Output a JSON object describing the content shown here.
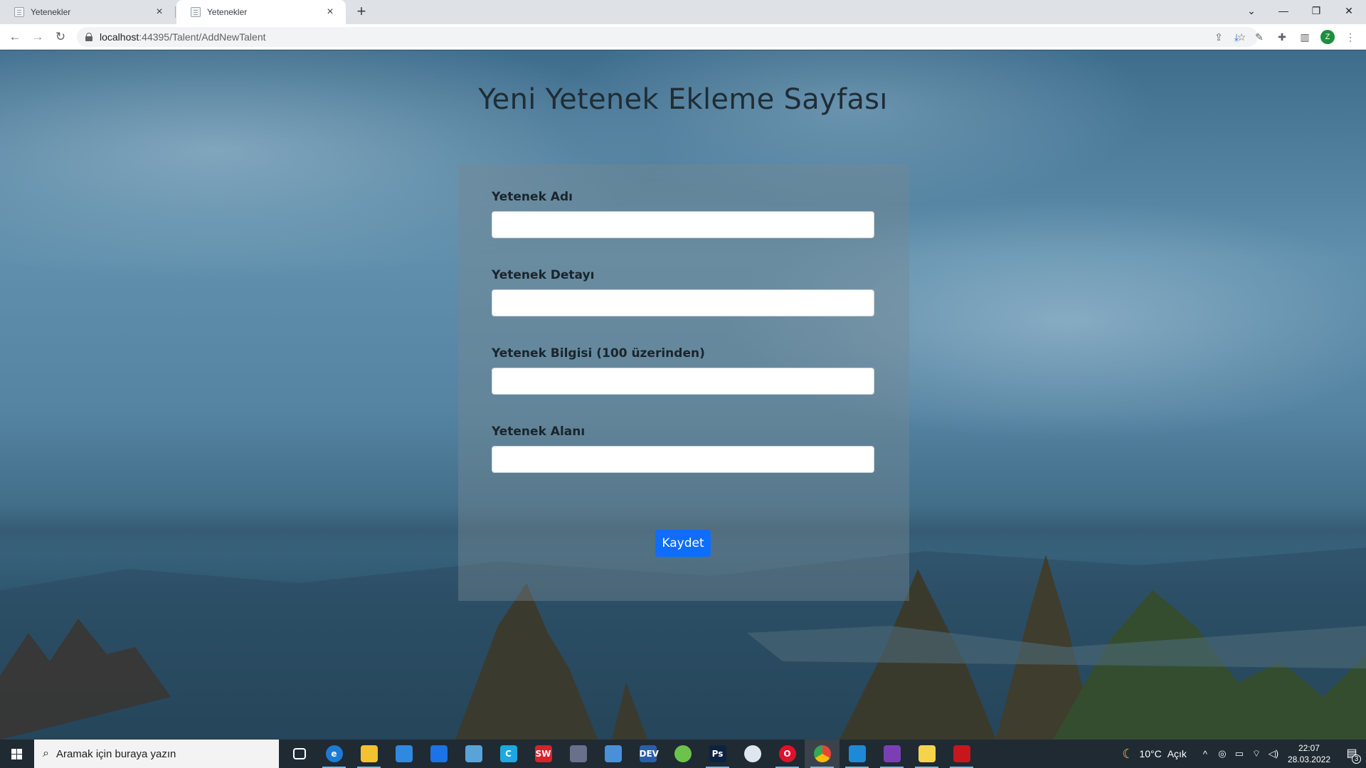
{
  "browser": {
    "tabs": [
      {
        "title": "Yetenekler"
      },
      {
        "title": "Yetenekler"
      }
    ],
    "new_tab_icon": "+",
    "url_host": "localhost",
    "url_path": ":44395/Talent/AddNewTalent",
    "window_controls": {
      "tab_list": "⌄",
      "minimize": "—",
      "maximize": "❐",
      "close": "✕"
    },
    "nav": {
      "back": "←",
      "forward": "→",
      "reload": "↻"
    },
    "profile_initial": "Z"
  },
  "page": {
    "title": "Yeni Yetenek Ekleme Sayfası",
    "fields": [
      {
        "label": "Yetenek Adı",
        "value": ""
      },
      {
        "label": "Yetenek Detayı",
        "value": ""
      },
      {
        "label": "Yetenek Bilgisi (100 üzerinden)",
        "value": ""
      },
      {
        "label": "Yetenek Alanı",
        "value": ""
      }
    ],
    "submit_label": "Kaydet"
  },
  "taskbar": {
    "search_placeholder": "Aramak için buraya yazın",
    "weather_temp": "10°C",
    "weather_text": "Açık",
    "time": "22:07",
    "date": "28.03.2022",
    "notification_count": "3",
    "apps": [
      {
        "name": "task-view",
        "label": "",
        "color": "#1f2a33"
      },
      {
        "name": "edge",
        "label": "e",
        "color": "#1e7bd4"
      },
      {
        "name": "file-explorer",
        "label": "",
        "color": "#f2c230"
      },
      {
        "name": "store",
        "label": "",
        "color": "#2d8ae0"
      },
      {
        "name": "mail",
        "label": "",
        "color": "#1a73e8"
      },
      {
        "name": "app-plane",
        "label": "",
        "color": "#5aa3d9"
      },
      {
        "name": "ccleaner",
        "label": "C",
        "color": "#1ea7e0"
      },
      {
        "name": "solidworks",
        "label": "SW",
        "color": "#d6232a"
      },
      {
        "name": "app-printer",
        "label": "",
        "color": "#6a6f8a"
      },
      {
        "name": "app-cube",
        "label": "",
        "color": "#4a90d9"
      },
      {
        "name": "dev-cpp",
        "label": "DEV",
        "color": "#2a5fa8"
      },
      {
        "name": "app-green",
        "label": "",
        "color": "#6cc24a"
      },
      {
        "name": "photoshop",
        "label": "Ps",
        "color": "#0c2340"
      },
      {
        "name": "app-circle",
        "label": "",
        "color": "#dfe6ee"
      },
      {
        "name": "opera",
        "label": "O",
        "color": "#e0112b"
      },
      {
        "name": "chrome",
        "label": "",
        "color": "#34a853"
      },
      {
        "name": "vscode",
        "label": "",
        "color": "#1e8ad6"
      },
      {
        "name": "visual-studio",
        "label": "",
        "color": "#7b3fb5"
      },
      {
        "name": "app-sticky",
        "label": "",
        "color": "#f6d44a"
      },
      {
        "name": "acrobat",
        "label": "",
        "color": "#c8161d"
      }
    ]
  }
}
